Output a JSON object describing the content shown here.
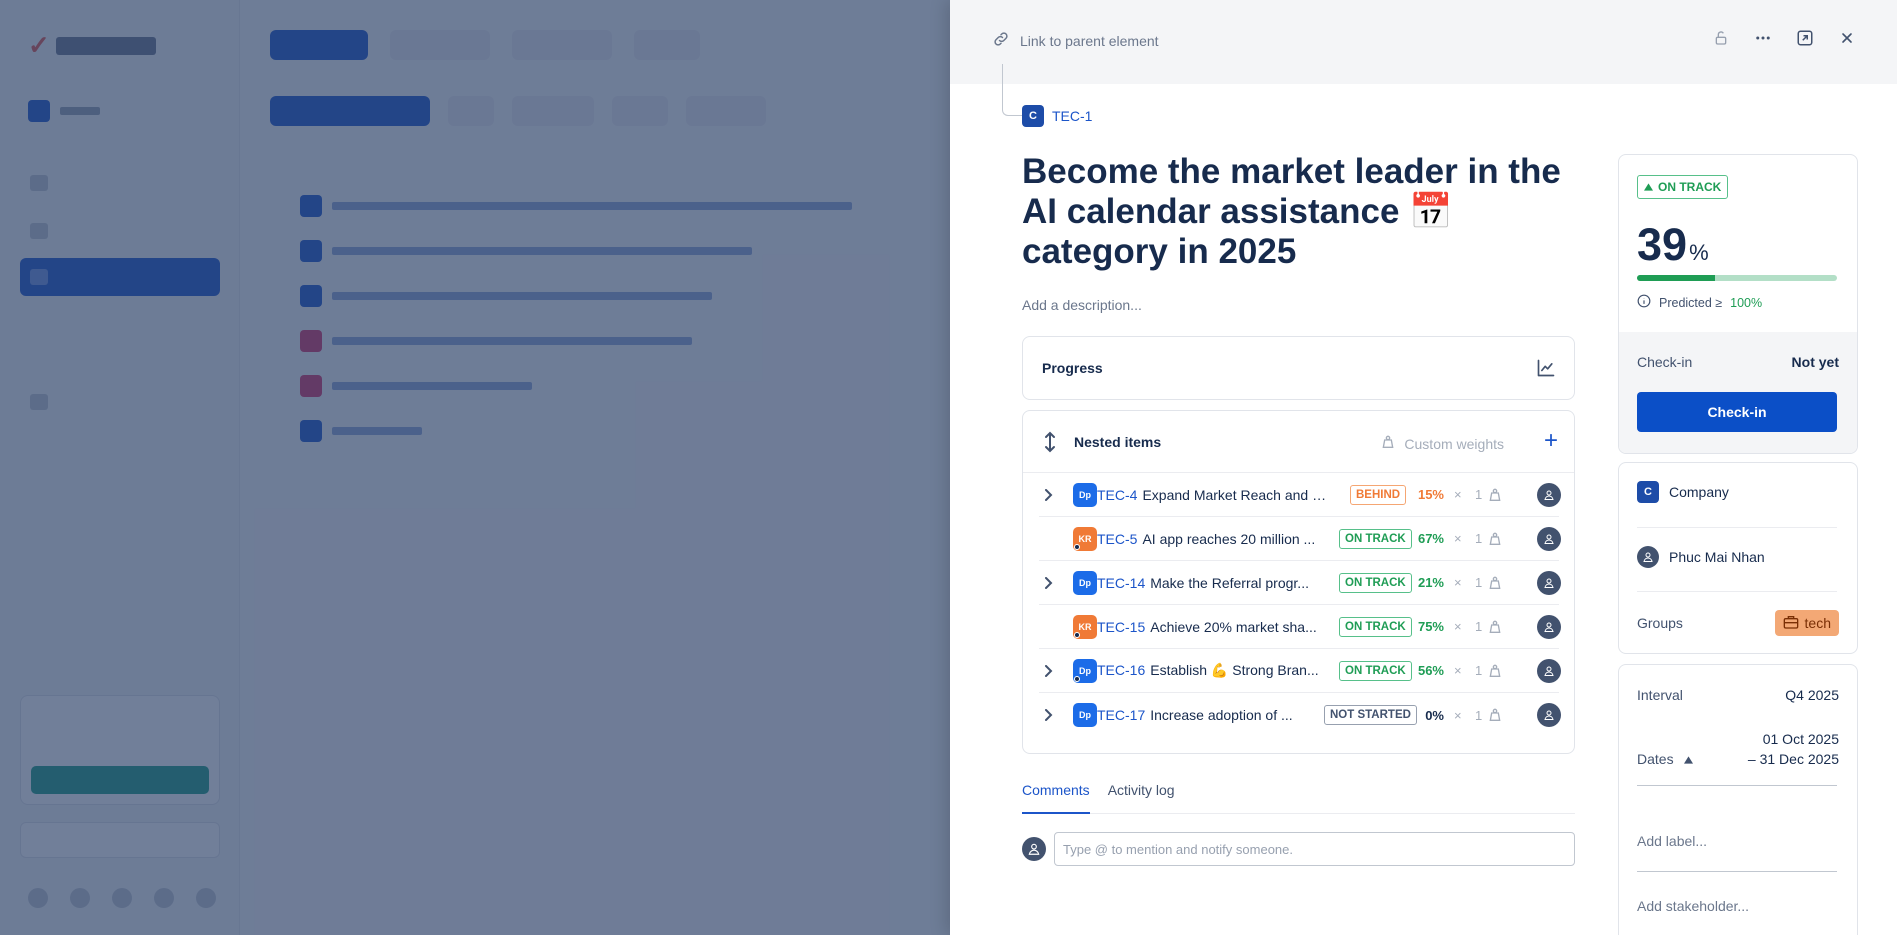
{
  "panel": {
    "link_parent_label": "Link to parent element",
    "parent": {
      "badge": "C",
      "key": "TEC-1"
    },
    "title": "Become the market leader in the AI calendar assistance 📅 category in 2025",
    "description_placeholder": "Add a description...",
    "progress_label": "Progress",
    "nested": {
      "label": "Nested items",
      "custom_weights_label": "Custom weights",
      "add_label": "+",
      "items": [
        {
          "expandable": true,
          "type": "Dp",
          "key": "TEC-4",
          "name": "Expand Market Reach and D...",
          "status": "BEHIND",
          "status_kind": "behind",
          "percent": "15%",
          "percent_color": "#f07a36",
          "mult": "×",
          "weight": "1",
          "owner_icon": "avatar"
        },
        {
          "expandable": false,
          "type": "KR",
          "key": "TEC-5",
          "name": "AI app reaches 20 million ...",
          "status": "ON TRACK",
          "status_kind": "on",
          "percent": "67%",
          "percent_color": "#1f9d55",
          "mult": "×",
          "weight": "1",
          "owner_icon": "avatar"
        },
        {
          "expandable": true,
          "type": "Dp",
          "key": "TEC-14",
          "name": "Make the Referral progr...",
          "status": "ON TRACK",
          "status_kind": "on",
          "percent": "21%",
          "percent_color": "#1f9d55",
          "mult": "×",
          "weight": "1",
          "owner_icon": "avatar"
        },
        {
          "expandable": false,
          "type": "KR",
          "key": "TEC-15",
          "name": "Achieve 20% market sha...",
          "status": "ON TRACK",
          "status_kind": "on",
          "percent": "75%",
          "percent_color": "#1f9d55",
          "mult": "×",
          "weight": "1",
          "owner_icon": "avatar"
        },
        {
          "expandable": true,
          "type": "Dp",
          "key": "TEC-16",
          "name": "Establish 💪 Strong Bran...",
          "status": "ON TRACK",
          "status_kind": "on",
          "percent": "56%",
          "percent_color": "#1f9d55",
          "mult": "×",
          "weight": "1",
          "owner_icon": "avatar"
        },
        {
          "expandable": true,
          "type": "Dp",
          "key": "TEC-17",
          "name": "Increase adoption of ...",
          "status": "NOT STARTED",
          "status_kind": "ns",
          "percent": "0%",
          "percent_color": "#172b4d",
          "mult": "×",
          "weight": "1",
          "owner_icon": "avatar"
        }
      ]
    },
    "tabs": {
      "comments": "Comments",
      "activity": "Activity log"
    },
    "comment_placeholder": "Type @ to mention and notify someone."
  },
  "sidebar_right": {
    "status": "ON TRACK",
    "progress_value": "39",
    "progress_unit": "%",
    "progress_fraction": 0.39,
    "predicted_label": "Predicted ≥",
    "predicted_value": "100%",
    "checkin_label": "Check-in",
    "checkin_status": "Not yet",
    "checkin_button": "Check-in",
    "company": {
      "badge": "C",
      "label": "Company"
    },
    "owner": "Phuc Mai Nhan",
    "groups_label": "Groups",
    "group_tag": "tech",
    "interval_label": "Interval",
    "interval_value": "Q4 2025",
    "dates_label": "Dates",
    "date_start": "01 Oct 2025",
    "date_end": "– 31 Dec 2025",
    "add_label": "Add label...",
    "add_stakeholder": "Add stakeholder..."
  },
  "colors": {
    "accent": "#1c55c9",
    "on_track": "#1f9d55",
    "behind": "#f07a36"
  }
}
